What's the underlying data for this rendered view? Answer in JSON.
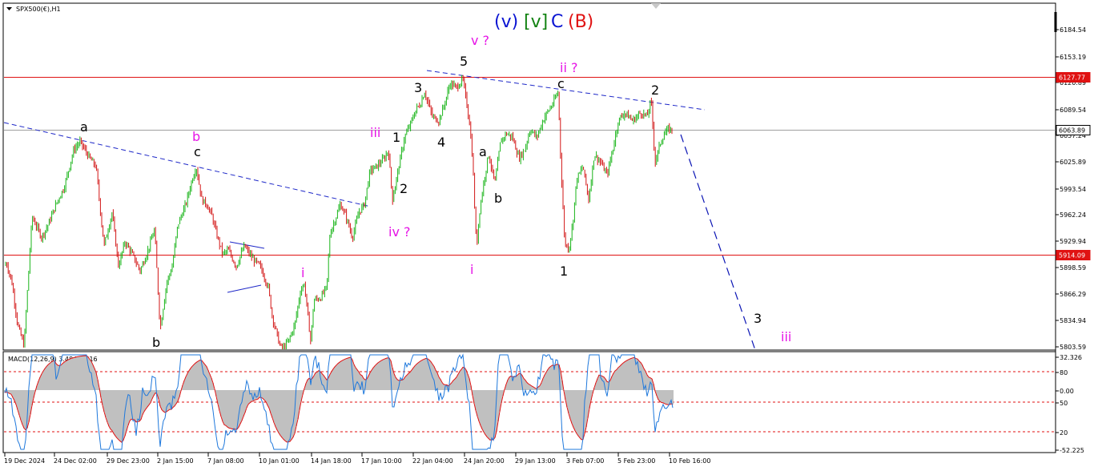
{
  "chart_data": [
    {
      "type": "candlestick",
      "instrument_label": "SPX500(€),H1",
      "title_parts": [
        {
          "text": "(v)",
          "color": "#0a14d2"
        },
        {
          "text": "[v]",
          "color": "#128212"
        },
        {
          "text": "C",
          "color": "#0a14d2"
        },
        {
          "text": "(B)",
          "color": "#e01212"
        }
      ],
      "ylim": [
        5803.59,
        6215.0
      ],
      "y_ticks": [
        "6184.54",
        "6153.19",
        "6120.89",
        "6089.54",
        "6057.24",
        "6025.89",
        "5993.54",
        "5962.24",
        "5929.94",
        "5898.59",
        "5866.29",
        "5834.94",
        "5803.59"
      ],
      "x_ticks": [
        "19 Dec 2024",
        "24 Dec 02:00",
        "29 Dec 23:00",
        "2 Jan 15:00",
        "7 Jan 08:00",
        "10 Jan 01:00",
        "14 Jan 18:00",
        "17 Jan 10:00",
        "22 Jan 04:00",
        "24 Jan 20:00",
        "29 Jan 13:00",
        "3 Feb 07:00",
        "5 Feb 23:00",
        "10 Feb 16:00"
      ],
      "price_levels": [
        {
          "label": "6127.77",
          "value": 6127.77,
          "kind": "horizontal-line",
          "color": "#e01212"
        },
        {
          "label": "6063.89",
          "value": 6063.89,
          "kind": "current-price",
          "color": "#a0a0a0"
        },
        {
          "label": "5914.09",
          "value": 5914.09,
          "kind": "horizontal-line",
          "color": "#e01212"
        }
      ],
      "close_path": [
        [
          0,
          5890
        ],
        [
          8,
          5905
        ],
        [
          15,
          5880
        ],
        [
          22,
          5830
        ],
        [
          30,
          5805
        ],
        [
          40,
          5960
        ],
        [
          52,
          5935
        ],
        [
          60,
          5950
        ],
        [
          70,
          5975
        ],
        [
          80,
          5995
        ],
        [
          92,
          6040
        ],
        [
          100,
          6050
        ],
        [
          112,
          6030
        ],
        [
          120,
          6020
        ],
        [
          126,
          5960
        ],
        [
          130,
          5925
        ],
        [
          140,
          5965
        ],
        [
          148,
          5900
        ],
        [
          156,
          5930
        ],
        [
          165,
          5915
        ],
        [
          175,
          5895
        ],
        [
          185,
          5920
        ],
        [
          193,
          5945
        ],
        [
          200,
          5825
        ],
        [
          208,
          5880
        ],
        [
          215,
          5900
        ],
        [
          222,
          5950
        ],
        [
          232,
          5975
        ],
        [
          240,
          6005
        ],
        [
          245,
          6020
        ],
        [
          252,
          5980
        ],
        [
          258,
          5975
        ],
        [
          265,
          5960
        ],
        [
          270,
          5940
        ],
        [
          278,
          5915
        ],
        [
          285,
          5920
        ],
        [
          295,
          5900
        ],
        [
          305,
          5925
        ],
        [
          315,
          5910
        ],
        [
          325,
          5900
        ],
        [
          335,
          5875
        ],
        [
          340,
          5840
        ],
        [
          348,
          5810
        ],
        [
          352,
          5800
        ],
        [
          360,
          5810
        ],
        [
          368,
          5830
        ],
        [
          375,
          5870
        ],
        [
          380,
          5880
        ],
        [
          385,
          5835
        ],
        [
          388,
          5810
        ],
        [
          392,
          5860
        ],
        [
          400,
          5862
        ],
        [
          408,
          5875
        ],
        [
          412,
          5940
        ],
        [
          418,
          5955
        ],
        [
          425,
          5975
        ],
        [
          432,
          5960
        ],
        [
          440,
          5935
        ],
        [
          448,
          5965
        ],
        [
          455,
          5975
        ],
        [
          462,
          6015
        ],
        [
          470,
          6020
        ],
        [
          480,
          6030
        ],
        [
          485,
          6040
        ],
        [
          490,
          5980
        ],
        [
          495,
          6005
        ],
        [
          500,
          6030
        ],
        [
          505,
          6055
        ],
        [
          512,
          6070
        ],
        [
          520,
          6090
        ],
        [
          525,
          6095
        ],
        [
          530,
          6110
        ],
        [
          540,
          6080
        ],
        [
          548,
          6075
        ],
        [
          555,
          6095
        ],
        [
          562,
          6120
        ],
        [
          570,
          6115
        ],
        [
          578,
          6125
        ],
        [
          582,
          6100
        ],
        [
          586,
          6075
        ],
        [
          590,
          6030
        ],
        [
          595,
          5920
        ],
        [
          598,
          5960
        ],
        [
          603,
          5995
        ],
        [
          610,
          6035
        ],
        [
          618,
          6000
        ],
        [
          625,
          6050
        ],
        [
          632,
          6060
        ],
        [
          640,
          6055
        ],
        [
          648,
          6030
        ],
        [
          655,
          6040
        ],
        [
          662,
          6065
        ],
        [
          670,
          6055
        ],
        [
          680,
          6080
        ],
        [
          690,
          6095
        ],
        [
          697,
          6110
        ],
        [
          700,
          6030
        ],
        [
          705,
          5930
        ],
        [
          710,
          5920
        ],
        [
          715,
          5950
        ],
        [
          720,
          6005
        ],
        [
          728,
          6020
        ],
        [
          735,
          5980
        ],
        [
          742,
          6035
        ],
        [
          750,
          6025
        ],
        [
          758,
          6010
        ],
        [
          765,
          6040
        ],
        [
          772,
          6075
        ],
        [
          780,
          6085
        ],
        [
          790,
          6075
        ],
        [
          800,
          6085
        ],
        [
          808,
          6080
        ],
        [
          813,
          6100
        ],
        [
          818,
          6025
        ],
        [
          825,
          6050
        ],
        [
          830,
          6060
        ],
        [
          835,
          6065
        ],
        [
          840,
          6063.89
        ]
      ],
      "annotations": [
        {
          "text": "a",
          "color": "#000000"
        },
        {
          "text": "b",
          "color": "#e614e6"
        },
        {
          "text": "c",
          "color": "#000000"
        },
        {
          "text": "b",
          "color": "#000000"
        },
        {
          "text": "i",
          "color": "#e614e6"
        },
        {
          "text": "iii",
          "color": "#e614e6"
        },
        {
          "text": "1",
          "color": "#000000"
        },
        {
          "text": "2",
          "color": "#000000"
        },
        {
          "text": "iv ?",
          "color": "#e614e6"
        },
        {
          "text": "3",
          "color": "#000000"
        },
        {
          "text": "4",
          "color": "#000000"
        },
        {
          "text": "5",
          "color": "#000000"
        },
        {
          "text": "v ?",
          "color": "#e614e6"
        },
        {
          "text": "i",
          "color": "#e614e6"
        },
        {
          "text": "a",
          "color": "#000000"
        },
        {
          "text": "b",
          "color": "#000000"
        },
        {
          "text": "ii ?",
          "color": "#e614e6"
        },
        {
          "text": "c",
          "color": "#000000"
        },
        {
          "text": "1",
          "color": "#000000"
        },
        {
          "text": "2",
          "color": "#000000"
        },
        {
          "text": "3",
          "color": "#000000"
        },
        {
          "text": "iii",
          "color": "#e614e6"
        }
      ],
      "colors": {
        "bull": "#18b418",
        "bear": "#d21414",
        "trend": "#1e28c8",
        "projection": "#0a14b4"
      }
    },
    {
      "type": "macd",
      "indicator_label": "MACD(12,26,9) 3.484 1.516",
      "ylim": [
        -52.225,
        32.326
      ],
      "y_ticks": [
        "32.326",
        "80",
        "0.00",
        "50",
        "20",
        "-52.225"
      ],
      "levels_dashed": [
        20,
        -10,
        -35
      ],
      "colors": {
        "histogram": "#c0c0c0",
        "signal": "#e01212",
        "macd": "#1e78dc"
      }
    }
  ]
}
